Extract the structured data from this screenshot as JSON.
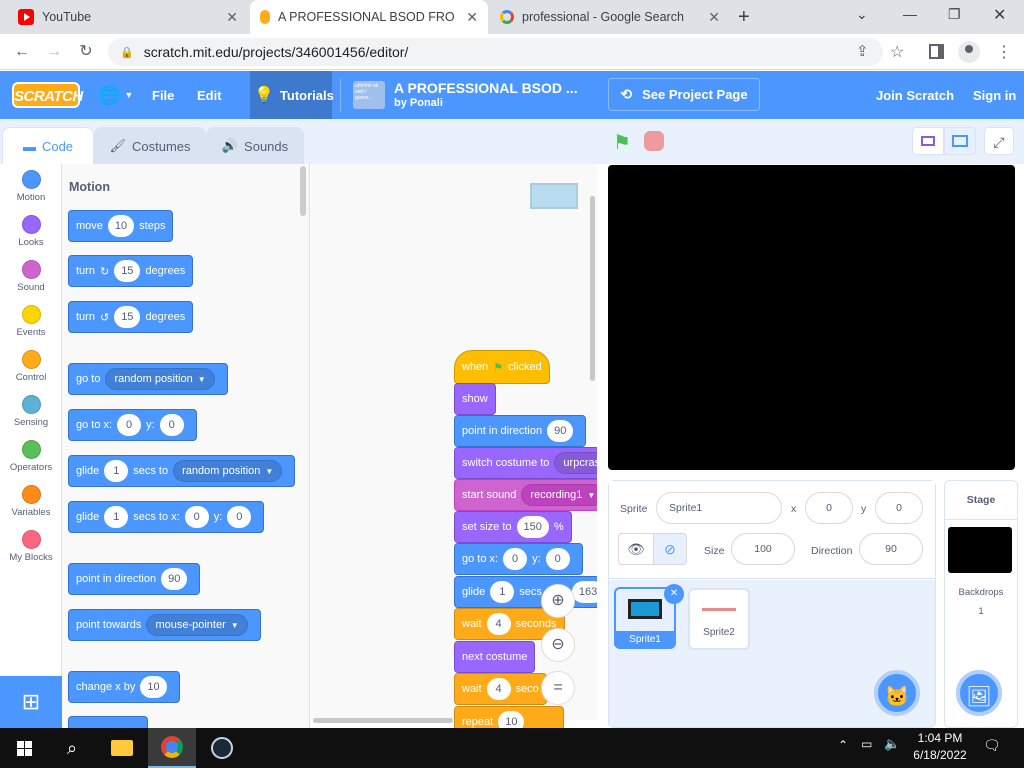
{
  "browser": {
    "tabs": [
      {
        "title": "YouTube",
        "close": "✕"
      },
      {
        "title": "A PROFESSIONAL BSOD FRO",
        "close": "✕"
      },
      {
        "title": "professional - Google Search",
        "close": "✕"
      }
    ],
    "new_tab": "+",
    "window_controls": {
      "minimize": "⌄",
      "restore": "—",
      "maximize": "❐",
      "close": "✕"
    },
    "url": "scratch.mit.edu/projects/346001456/editor/"
  },
  "menubar": {
    "logo": "SCRATCH",
    "file": "File",
    "edit": "Edit",
    "tutorials": "Tutorials",
    "project_thumb_text": "uhhhhh ok well i guess..",
    "project_title": "A PROFESSIONAL BSOD ...",
    "project_author": "by Ponali",
    "see_project": "See Project Page",
    "join": "Join Scratch",
    "signin": "Sign in"
  },
  "editor_tabs": {
    "code": "Code",
    "costumes": "Costumes",
    "sounds": "Sounds"
  },
  "categories": [
    {
      "label": "Motion",
      "color": "#4c97ff"
    },
    {
      "label": "Looks",
      "color": "#9966ff"
    },
    {
      "label": "Sound",
      "color": "#cf63cf"
    },
    {
      "label": "Events",
      "color": "#ffd500"
    },
    {
      "label": "Control",
      "color": "#ffab19"
    },
    {
      "label": "Sensing",
      "color": "#5cb1d6"
    },
    {
      "label": "Operators",
      "color": "#59c059"
    },
    {
      "label": "Variables",
      "color": "#ff8c1a"
    },
    {
      "label": "My Blocks",
      "color": "#ff6680"
    }
  ],
  "palette": {
    "header": "Motion",
    "blocks": {
      "move": {
        "a": "move",
        "v": "10",
        "b": "steps"
      },
      "turn_right": {
        "a": "turn",
        "v": "15",
        "b": "degrees"
      },
      "turn_left": {
        "a": "turn",
        "v": "15",
        "b": "degrees"
      },
      "goto": {
        "a": "go to",
        "dd": "random position"
      },
      "gotoxy": {
        "a": "go to x:",
        "x": "0",
        "ylab": "y:",
        "y": "0"
      },
      "glide_rand": {
        "a": "glide",
        "v": "1",
        "b": "secs to",
        "dd": "random position"
      },
      "glide_xy": {
        "a": "glide",
        "v": "1",
        "b": "secs to x:",
        "x": "0",
        "ylab": "y:",
        "y": "0"
      },
      "point_dir": {
        "a": "point in direction",
        "v": "90"
      },
      "point_towards": {
        "a": "point towards",
        "dd": "mouse-pointer"
      },
      "change_x": {
        "a": "change x by",
        "v": "10"
      }
    }
  },
  "script": {
    "hat": {
      "a": "when",
      "b": "clicked"
    },
    "show": "show",
    "point_dir": {
      "a": "point in direction",
      "v": "90"
    },
    "switch_costume": {
      "a": "switch costume to",
      "dd": "urpcrash"
    },
    "start_sound": {
      "a": "start sound",
      "dd": "recording1"
    },
    "set_size": {
      "a": "set size to",
      "v": "150",
      "b": "%"
    },
    "gotoxy": {
      "a": "go to x:",
      "x": "0",
      "ylab": "y:",
      "y": "0"
    },
    "glide": {
      "a": "glide",
      "v": "1",
      "b": "secs",
      "x": "163"
    },
    "wait1": {
      "a": "wait",
      "v": "4",
      "b": "seconds"
    },
    "next_costume": "next costume",
    "wait2": {
      "a": "wait",
      "v": "4",
      "b": "seco"
    },
    "repeat": {
      "a": "repeat",
      "v": "10"
    }
  },
  "sprite_info": {
    "sprite_label": "Sprite",
    "sprite_name": "Sprite1",
    "x_label": "x",
    "x": "0",
    "y_label": "y",
    "y": "0",
    "size_label": "Size",
    "size": "100",
    "direction_label": "Direction",
    "direction": "90"
  },
  "sprites": [
    {
      "name": "Sprite1"
    },
    {
      "name": "Sprite2"
    }
  ],
  "stage_pane": {
    "title": "Stage",
    "backdrops_label": "Backdrops",
    "backdrops_count": "1"
  },
  "taskbar": {
    "time": "1:04 PM",
    "date": "6/18/2022"
  }
}
